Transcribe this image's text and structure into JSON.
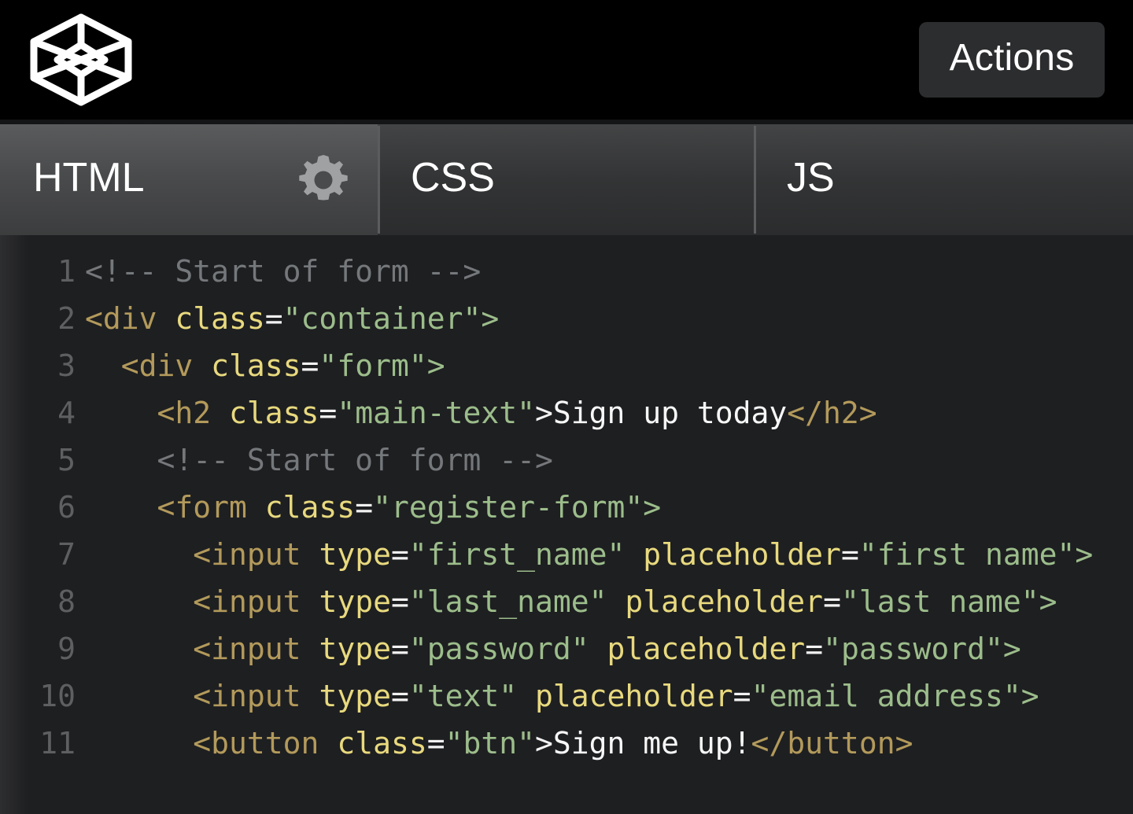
{
  "header": {
    "logo_icon": "codepen-logo-icon",
    "actions_label": "Actions"
  },
  "tabs": [
    {
      "id": "html",
      "label": "HTML",
      "active": true,
      "has_gear": true,
      "gear_icon": "gear-icon"
    },
    {
      "id": "css",
      "label": "CSS",
      "active": false,
      "has_gear": false,
      "gear_icon": ""
    },
    {
      "id": "js",
      "label": "JS",
      "active": false,
      "has_gear": false,
      "gear_icon": ""
    }
  ],
  "editor": {
    "language": "HTML",
    "line_numbers": [
      "1",
      "2",
      "3",
      "4",
      "5",
      "6",
      "7",
      "8",
      "9",
      "10",
      "11"
    ],
    "lines": [
      {
        "number": "1",
        "raw": "<!-- Start of form -->"
      },
      {
        "number": "2",
        "raw": "<div class=\"container\">"
      },
      {
        "number": "3",
        "raw": "  <div class=\"form\">"
      },
      {
        "number": "4",
        "raw": "    <h2 class=\"main-text\">Sign up today</h2>"
      },
      {
        "number": "5",
        "raw": "    <!-- Start of form -->"
      },
      {
        "number": "6",
        "raw": "    <form class=\"register-form\">"
      },
      {
        "number": "7",
        "raw": "      <input type=\"first_name\" placeholder=\"first name\">"
      },
      {
        "number": "8",
        "raw": "      <input type=\"last_name\" placeholder=\"last name\">"
      },
      {
        "number": "9",
        "raw": "      <input type=\"password\" placeholder=\"password\">"
      },
      {
        "number": "10",
        "raw": "      <input type=\"text\" placeholder=\"email address\">"
      },
      {
        "number": "11",
        "raw": "      <button class=\"btn\">Sign me up!</button>"
      }
    ],
    "tokens": [
      [
        {
          "c": "comment",
          "s": "<!-- Start of form -->"
        }
      ],
      [
        {
          "c": "tag",
          "s": "<div "
        },
        {
          "c": "attr",
          "s": "class"
        },
        {
          "c": "punct",
          "s": "="
        },
        {
          "c": "string",
          "s": "\"container\">"
        }
      ],
      [
        {
          "c": "plain",
          "s": "  "
        },
        {
          "c": "tag",
          "s": "<div "
        },
        {
          "c": "attr",
          "s": "class"
        },
        {
          "c": "punct",
          "s": "="
        },
        {
          "c": "string",
          "s": "\"form\">"
        }
      ],
      [
        {
          "c": "plain",
          "s": "    "
        },
        {
          "c": "tag",
          "s": "<h2 "
        },
        {
          "c": "attr",
          "s": "class"
        },
        {
          "c": "punct",
          "s": "="
        },
        {
          "c": "string",
          "s": "\"main-text\""
        },
        {
          "c": "punct",
          "s": ">"
        },
        {
          "c": "text",
          "s": "Sign up today"
        },
        {
          "c": "tag",
          "s": "</h2>"
        }
      ],
      [
        {
          "c": "plain",
          "s": "    "
        },
        {
          "c": "comment",
          "s": "<!-- Start of form -->"
        }
      ],
      [
        {
          "c": "plain",
          "s": "    "
        },
        {
          "c": "tag",
          "s": "<form "
        },
        {
          "c": "attr",
          "s": "class"
        },
        {
          "c": "punct",
          "s": "="
        },
        {
          "c": "string",
          "s": "\"register-form\">"
        }
      ],
      [
        {
          "c": "plain",
          "s": "      "
        },
        {
          "c": "tag",
          "s": "<input "
        },
        {
          "c": "attr",
          "s": "type"
        },
        {
          "c": "punct",
          "s": "="
        },
        {
          "c": "string",
          "s": "\"first_name\" "
        },
        {
          "c": "attr",
          "s": "placeholder"
        },
        {
          "c": "punct",
          "s": "="
        },
        {
          "c": "string",
          "s": "\"first name\">"
        }
      ],
      [
        {
          "c": "plain",
          "s": "      "
        },
        {
          "c": "tag",
          "s": "<input "
        },
        {
          "c": "attr",
          "s": "type"
        },
        {
          "c": "punct",
          "s": "="
        },
        {
          "c": "string",
          "s": "\"last_name\" "
        },
        {
          "c": "attr",
          "s": "placeholder"
        },
        {
          "c": "punct",
          "s": "="
        },
        {
          "c": "string",
          "s": "\"last name\">"
        }
      ],
      [
        {
          "c": "plain",
          "s": "      "
        },
        {
          "c": "tag",
          "s": "<input "
        },
        {
          "c": "attr",
          "s": "type"
        },
        {
          "c": "punct",
          "s": "="
        },
        {
          "c": "string",
          "s": "\"password\" "
        },
        {
          "c": "attr",
          "s": "placeholder"
        },
        {
          "c": "punct",
          "s": "="
        },
        {
          "c": "string",
          "s": "\"password\">"
        }
      ],
      [
        {
          "c": "plain",
          "s": "      "
        },
        {
          "c": "tag",
          "s": "<input "
        },
        {
          "c": "attr",
          "s": "type"
        },
        {
          "c": "punct",
          "s": "="
        },
        {
          "c": "string",
          "s": "\"text\" "
        },
        {
          "c": "attr",
          "s": "placeholder"
        },
        {
          "c": "punct",
          "s": "="
        },
        {
          "c": "string",
          "s": "\"email address\">"
        }
      ],
      [
        {
          "c": "plain",
          "s": "      "
        },
        {
          "c": "tag",
          "s": "<button "
        },
        {
          "c": "attr",
          "s": "class"
        },
        {
          "c": "punct",
          "s": "="
        },
        {
          "c": "string",
          "s": "\"btn\""
        },
        {
          "c": "punct",
          "s": ">"
        },
        {
          "c": "text",
          "s": "Sign me up!"
        },
        {
          "c": "tag",
          "s": "</button>"
        }
      ]
    ]
  },
  "colors": {
    "header_bg": "#000000",
    "actions_bg": "#2c2d2e",
    "tab_active_top": "#5a5b5c",
    "tab_inactive_top": "#434445",
    "editor_bg": "#1e1f21",
    "gutter_text": "#5d5f61",
    "token_comment": "#75787b",
    "token_tag": "#b39a5b",
    "token_attr": "#e8d97e",
    "token_string": "#9cbd8b",
    "token_text": "#f7f7f7",
    "gear": "#a0a1a2"
  }
}
